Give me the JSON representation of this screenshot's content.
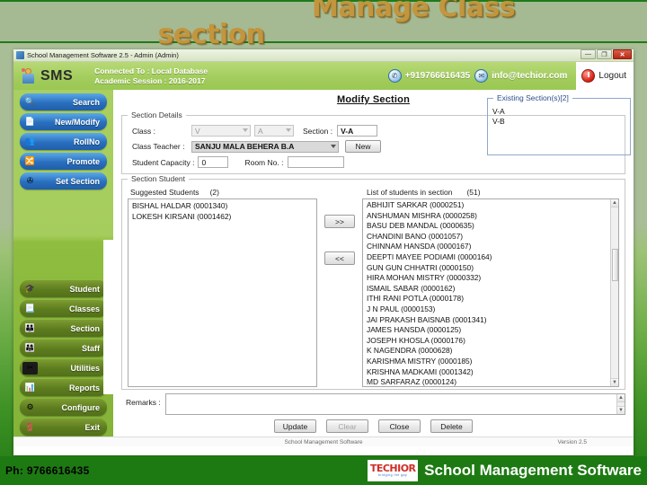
{
  "slide": {
    "title_line1": "Manage Class",
    "title_line2": "section",
    "title_color": "#c2963e"
  },
  "window": {
    "titlebar_text": "School Management Software 2.5  -  Admin (Admin)",
    "minimize_glyph": "—",
    "maximize_glyph": "❐",
    "close_glyph": "✕"
  },
  "header": {
    "brand": "SMS",
    "connected_to": "Connected To : Local Database",
    "academic_session": "Academic Session : 2016-2017",
    "phone": "+919766616435",
    "email": "info@techior.com",
    "logout_label": "Logout",
    "phone_icon": "phone-icon",
    "email_icon": "envelope-icon",
    "power_icon": "power-icon"
  },
  "sidebar": {
    "top_items": [
      {
        "label": "Search",
        "icon": "magnifier-icon"
      },
      {
        "label": "New/Modify",
        "icon": "document-new-icon"
      },
      {
        "label": "RollNo",
        "icon": "group-icon"
      },
      {
        "label": "Promote",
        "icon": "arrows-icon"
      },
      {
        "label": "Set Section",
        "icon": "section-icon"
      }
    ],
    "bottom_items": [
      {
        "label": "Student",
        "icon": "student-icon"
      },
      {
        "label": "Classes",
        "icon": "page-icon"
      },
      {
        "label": "Section",
        "icon": "people-icon"
      },
      {
        "label": "Staff",
        "icon": "staff-icon"
      },
      {
        "label": "Utilities",
        "icon": "tools-icon"
      },
      {
        "label": "Reports",
        "icon": "bar-chart-icon"
      },
      {
        "label": "Configure",
        "icon": "gear-icon"
      },
      {
        "label": "Exit",
        "icon": "exit-icon"
      }
    ]
  },
  "form": {
    "title": "Modify Section",
    "section_details_legend": "Section Details",
    "class_label": "Class :",
    "class_value": "V",
    "class_section_value": "A",
    "section_label": "Section :",
    "section_value": "V-A",
    "class_teacher_label": "Class Teacher :",
    "class_teacher_value": "SANJU MALA BEHERA B.A",
    "new_button": "New",
    "student_capacity_label": "Student Capacity :",
    "student_capacity_value": "0",
    "room_no_label": "Room No. :",
    "room_no_value": "",
    "existing_sections_legend": "Existing Section(s)[2]",
    "existing_sections": [
      "V-A",
      "V-B"
    ],
    "section_student_legend": "Section Student",
    "suggested_students_label": "Suggested Students",
    "suggested_students_count": "(2)",
    "suggested_students": [
      "BISHAL  HALDAR (0001340)",
      "LOKESH  KIRSANI (0001462)"
    ],
    "list_in_section_label": "List of students in section",
    "list_in_section_count": "(51)",
    "students_in_section": [
      "ABHIJIT  SARKAR (0000251)",
      "ANSHUMAN  MISHRA (0000258)",
      "BASU DEB MANDAL (0000635)",
      "CHANDINI  BANO (0001057)",
      "CHINNAM  HANSDA (0000167)",
      "DEEPTI MAYEE  PODIAMI (0000164)",
      "GUN GUN CHHATRI (0000150)",
      "HIRA MOHAN MISTRY (0000332)",
      "ISMAIL  SABAR (0000162)",
      "ITHI RANI POTLA (0000178)",
      "J N PAUL   (0000153)",
      "JAI PRAKASH BAISNAB (0001341)",
      "JAMES  HANSDA (0000125)",
      "JOSEPH  KHOSLA (0000176)",
      "K NAGENDRA   (0000628)",
      "KARISHMA  MISTRY (0000185)",
      "KRISHNA  MADKAMI (0001342)",
      "MD  SARFARAZ  (0000124)"
    ],
    "move_right_button": ">>",
    "move_left_button": "<<",
    "remarks_label": "Remarks :",
    "remarks_value": "",
    "buttons": [
      {
        "label": "Update",
        "disabled": false
      },
      {
        "label": "Clear",
        "disabled": true
      },
      {
        "label": "Close",
        "disabled": false
      },
      {
        "label": "Delete",
        "disabled": false
      }
    ]
  },
  "status_bar": {
    "center_text": "School Management Software",
    "version": "Version 2.5"
  },
  "footer": {
    "phone": "Ph: 9766616435",
    "logo_text": "TECHIOR",
    "logo_tagline": "bridging the gap",
    "title": "School Management Software"
  }
}
